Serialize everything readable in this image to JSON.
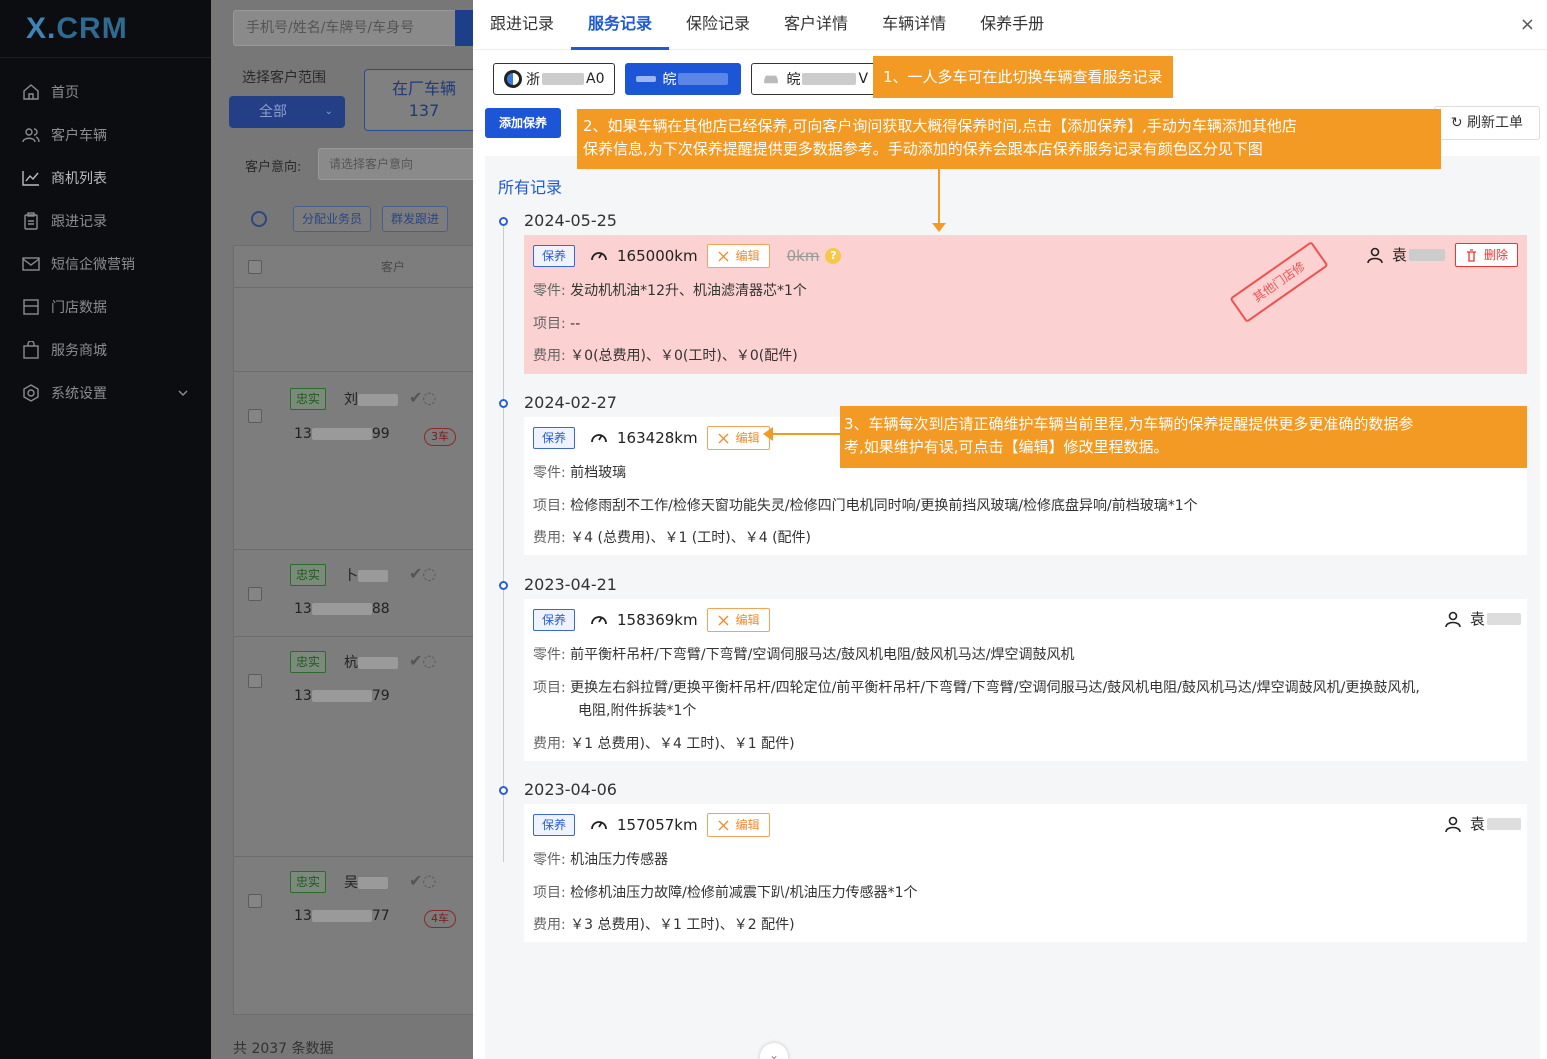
{
  "app": {
    "logo_x": "X.",
    "logo_crm": "CRM"
  },
  "sidebar": {
    "items": [
      {
        "label": "首页",
        "icon": "home-icon"
      },
      {
        "label": "客户车辆",
        "icon": "users-icon"
      },
      {
        "label": "商机列表",
        "icon": "chart-line-icon"
      },
      {
        "label": "跟进记录",
        "icon": "clipboard-icon"
      },
      {
        "label": "短信企微营销",
        "icon": "mail-icon"
      },
      {
        "label": "门店数据",
        "icon": "store-icon"
      },
      {
        "label": "服务商城",
        "icon": "shopping-bag-icon"
      },
      {
        "label": "系统设置",
        "icon": "gear-icon"
      }
    ]
  },
  "background": {
    "search_placeholder": "手机号/姓名/车牌号/车身号",
    "range_label": "选择客户范围",
    "range_value": "全部",
    "in_shop_label": "在厂车辆",
    "in_shop_count": "137",
    "intent_label": "客户意向:",
    "intent_placeholder": "请选择客户意向",
    "assign_btn": "分配业务员",
    "group_btn": "群发跟进",
    "col_customer": "客户",
    "rows": [
      {
        "tag": "忠实",
        "name": "刘",
        "phone_pre": "13",
        "phone_suf": "99",
        "cars": "3车"
      },
      {
        "tag": "忠实",
        "name": "卜",
        "phone_pre": "13",
        "phone_suf": "88",
        "cars": ""
      },
      {
        "tag": "忠实",
        "name": "杭",
        "phone_pre": "13",
        "phone_suf": "79",
        "cars": ""
      },
      {
        "tag": "忠实",
        "name": "吴",
        "phone_pre": "13",
        "phone_suf": "77",
        "cars": "4车"
      }
    ],
    "footer": "共 2037 条数据"
  },
  "drawer": {
    "tabs": [
      "跟进记录",
      "服务记录",
      "保险记录",
      "客户详情",
      "车辆详情",
      "保养手册"
    ],
    "active_tab": 1,
    "close": "×",
    "cars": [
      {
        "prefix": "浙",
        "suffix": "A0"
      },
      {
        "prefix": "皖",
        "suffix": ""
      },
      {
        "prefix": "皖",
        "suffix": "V"
      }
    ],
    "add_btn": "添加保养",
    "refresh_btn": "刷新工单",
    "all_records": "所有记录",
    "records": [
      {
        "date": "2024-05-25",
        "tag": "保养",
        "mileage": "165000km",
        "edit": "编辑",
        "old_mileage": "0km",
        "question": "?",
        "person": "袁",
        "delete": "删除",
        "stamp": "其他门店修",
        "parts_k": "零件:",
        "parts_v": "发动机机油*12升、机油滤清器芯*1个",
        "items_k": "项目:",
        "items_v": "--",
        "fee_k": "费用:",
        "fee_v": "￥0(总费用)、￥0(工时)、￥0(配件)"
      },
      {
        "date": "2024-02-27",
        "tag": "保养",
        "mileage": "163428km",
        "edit": "编辑",
        "parts_k": "零件:",
        "parts_v": "前档玻璃",
        "items_k": "项目:",
        "items_v": "检修雨刮不工作/检修天窗功能失灵/检修四门电机同时响/更换前挡风玻璃/检修底盘异响/前档玻璃*1个",
        "fee_k": "费用:",
        "fee_v": "￥4  (总费用)、￥1  (工时)、￥4  (配件)"
      },
      {
        "date": "2023-04-21",
        "tag": "保养",
        "mileage": "158369km",
        "edit": "编辑",
        "person": "袁",
        "parts_k": "零件:",
        "parts_v": "前平衡杆吊杆/下弯臂/下弯臂/空调伺服马达/鼓风机电阻/鼓风机马达/焊空调鼓风机",
        "items_k": "项目:",
        "items_v": "更换左右斜拉臂/更换平衡杆吊杆/四轮定位/前平衡杆吊杆/下弯臂/下弯臂/空调伺服马达/鼓风机电阻/鼓风机马达/焊空调鼓风机/更换鼓风机,",
        "items_v2": "电阻,附件拆装*1个",
        "fee_k": "费用:",
        "fee_v": "￥1  总费用)、￥4  工时)、￥1  配件)"
      },
      {
        "date": "2023-04-06",
        "tag": "保养",
        "mileage": "157057km",
        "edit": "编辑",
        "person": "袁",
        "parts_k": "零件:",
        "parts_v": "机油压力传感器",
        "items_k": "项目:",
        "items_v": "检修机油压力故障/检修前减震下趴/机油压力传感器*1个",
        "fee_k": "费用:",
        "fee_v": "￥3  总费用)、￥1  工时)、￥2  配件)"
      }
    ],
    "callouts": {
      "c1": "1、一人多车可在此切换车辆查看服务记录",
      "c2a": "2、如果车辆在其他店已经保养,可向客户询问获取大概得保养时间,点击【添加保养】,手动为车辆添加其他店",
      "c2b": "保养信息,为下次保养提醒提供更多数据参考。手动添加的保养会跟本店保养服务记录有颜色区分见下图",
      "c3a": "3、车辆每次到店请正确维护车辆当前里程,为车辆的保养提醒提供更多更准确的数据参",
      "c3b": "考,如果维护有误,可点击【编辑】修改里程数据。"
    }
  },
  "colors": {
    "primary": "#1f5ad6",
    "callout": "#f29a24",
    "other_shop_bg": "#fbd1d1",
    "delete": "#ee3333"
  }
}
